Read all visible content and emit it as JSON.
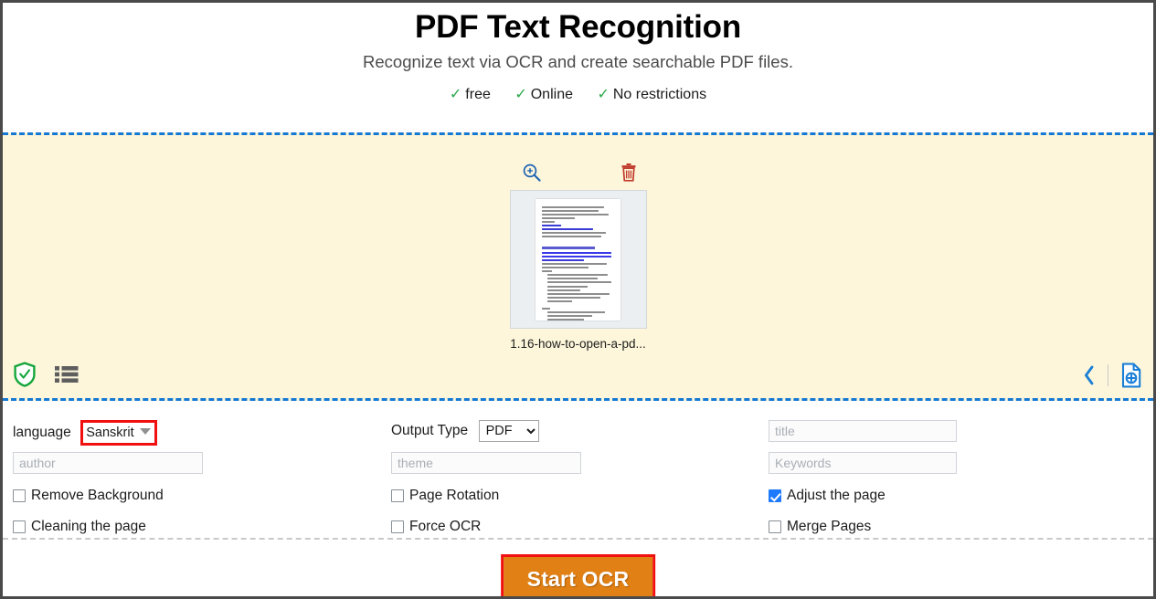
{
  "header": {
    "title": "PDF Text Recognition",
    "subtitle": "Recognize text via OCR and create searchable PDF files.",
    "features": [
      {
        "check": "✓",
        "label": "free"
      },
      {
        "check": "✓",
        "label": "Online"
      },
      {
        "check": "✓",
        "label": "No restrictions"
      }
    ]
  },
  "dropzone": {
    "file": {
      "name": "1.16-how-to-open-a-pd...",
      "zoom_icon": "magnify-plus-icon",
      "delete_icon": "trash-icon"
    },
    "toolbar_left": [
      {
        "icon": "shield-check-icon",
        "name": "secure-badge"
      },
      {
        "icon": "list-icon",
        "name": "list-view-toggle"
      }
    ],
    "toolbar_right": [
      {
        "icon": "chevron-left-icon",
        "name": "previous-page-button"
      },
      {
        "icon": "add-file-icon",
        "name": "add-file-button"
      }
    ],
    "border_color": "#1578d3",
    "background_color": "#fdf6da"
  },
  "options": {
    "language_label": "language",
    "language_value": "Sanskrit",
    "language_options": [
      "Sanskrit"
    ],
    "language_highlight_color": "#f01010",
    "output_type_label": "Output Type",
    "output_type_value": "PDF",
    "output_type_options": [
      "PDF"
    ],
    "author_placeholder": "author",
    "theme_placeholder": "theme",
    "title_placeholder": "title",
    "keywords_placeholder": "Keywords",
    "author_value": "",
    "theme_value": "",
    "title_value": "",
    "keywords_value": "",
    "checkboxes": [
      {
        "label": "Remove Background",
        "checked": false
      },
      {
        "label": "Cleaning the page",
        "checked": false
      },
      {
        "label": "Page Rotation",
        "checked": false
      },
      {
        "label": "Force OCR",
        "checked": false
      },
      {
        "label": "Adjust the page",
        "checked": true
      },
      {
        "label": "Merge Pages",
        "checked": false
      }
    ],
    "checked_color": "#1d7afc"
  },
  "action": {
    "start_label": "Start OCR",
    "button_color": "#e18014",
    "highlight_color": "#f01010"
  }
}
